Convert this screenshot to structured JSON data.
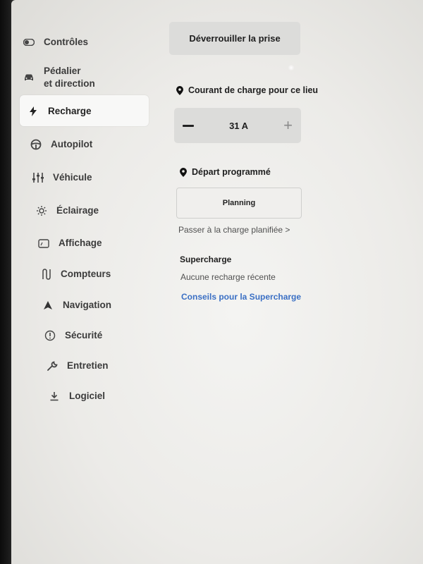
{
  "sidebar": {
    "items": [
      {
        "label": "Contrôles",
        "icon": "toggle-icon"
      },
      {
        "label": "Pédalier\net direction",
        "icon": "car-icon"
      },
      {
        "label": "Recharge",
        "icon": "bolt-icon",
        "selected": true
      },
      {
        "label": "Autopilot",
        "icon": "steering-wheel-icon"
      },
      {
        "label": "Véhicule",
        "icon": "sliders-icon"
      },
      {
        "label": "Éclairage",
        "icon": "sun-icon"
      },
      {
        "label": "Affichage",
        "icon": "display-icon"
      },
      {
        "label": "Compteurs",
        "icon": "route-icon"
      },
      {
        "label": "Navigation",
        "icon": "navigation-arrow-icon"
      },
      {
        "label": "Sécurité",
        "icon": "alert-circle-icon"
      },
      {
        "label": "Entretien",
        "icon": "wrench-icon"
      },
      {
        "label": "Logiciel",
        "icon": "download-icon"
      }
    ]
  },
  "main": {
    "unlock_button": "Déverrouiller la prise",
    "charge_current": {
      "title": "Courant de charge pour ce lieu",
      "value": "31 A",
      "minus": "−",
      "plus": "+"
    },
    "departure": {
      "title": "Départ programmé",
      "planning_button": "Planning",
      "scheduled_link": "Passer à la charge planifiée >"
    },
    "supercharge": {
      "title": "Supercharge",
      "status": "Aucune recharge récente",
      "tips_link": "Conseils pour la Supercharge"
    }
  },
  "colors": {
    "accent_link": "#3a6fc4",
    "panel_bg": "#ecebe8",
    "button_bg": "#dcdcda"
  }
}
